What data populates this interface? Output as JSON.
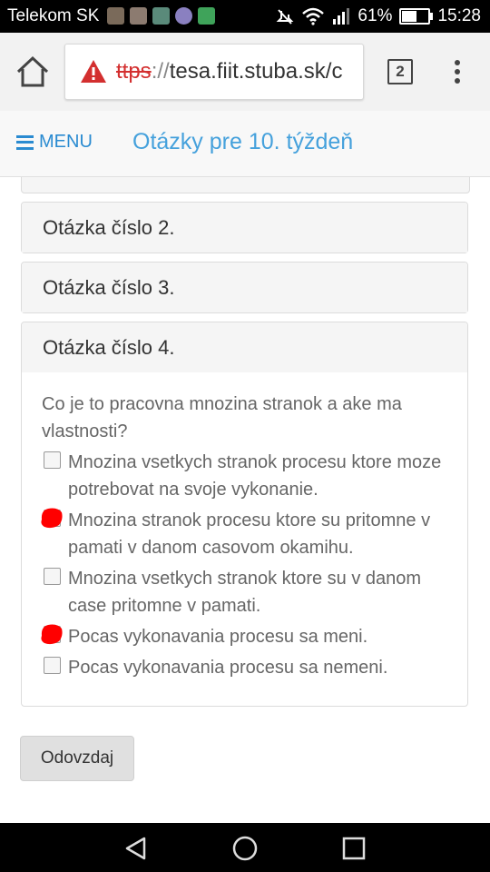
{
  "status_bar": {
    "carrier": "Telekom SK",
    "battery": "61%",
    "battery_level": 0.61,
    "time": "15:28"
  },
  "browser": {
    "url_scheme": "ttps",
    "url_sep": "://",
    "url_host": "tesa.fiit.stuba.sk/c",
    "tab_count": "2"
  },
  "header": {
    "menu_label": "MENU",
    "title": "Otázky pre 10. týždeň"
  },
  "questions": {
    "q2_title": "Otázka číslo 2.",
    "q3_title": "Otázka číslo 3.",
    "q4_title": "Otázka číslo 4.",
    "q4_text": "Co je to pracovna mnozina stranok a ake ma vlastnosti?",
    "q4_options": [
      {
        "label": "Mnozina vsetkych stranok procesu ktore moze potrebovat na svoje vykonanie.",
        "checked": false
      },
      {
        "label": "Mnozina stranok procesu ktore su pritomne v pamati v danom casovom okamihu.",
        "checked": true
      },
      {
        "label": "Mnozina vsetkych stranok ktore su v danom case pritomne v pamati.",
        "checked": false
      },
      {
        "label": "Pocas vykonavania procesu sa meni.",
        "checked": true
      },
      {
        "label": "Pocas vykonavania procesu sa nemeni.",
        "checked": false
      }
    ]
  },
  "submit_label": "Odovzdaj",
  "colors": {
    "accent": "#2a8bd1",
    "title": "#45a1dc",
    "warning": "#d32f2f",
    "scribble": "#ff0000"
  }
}
